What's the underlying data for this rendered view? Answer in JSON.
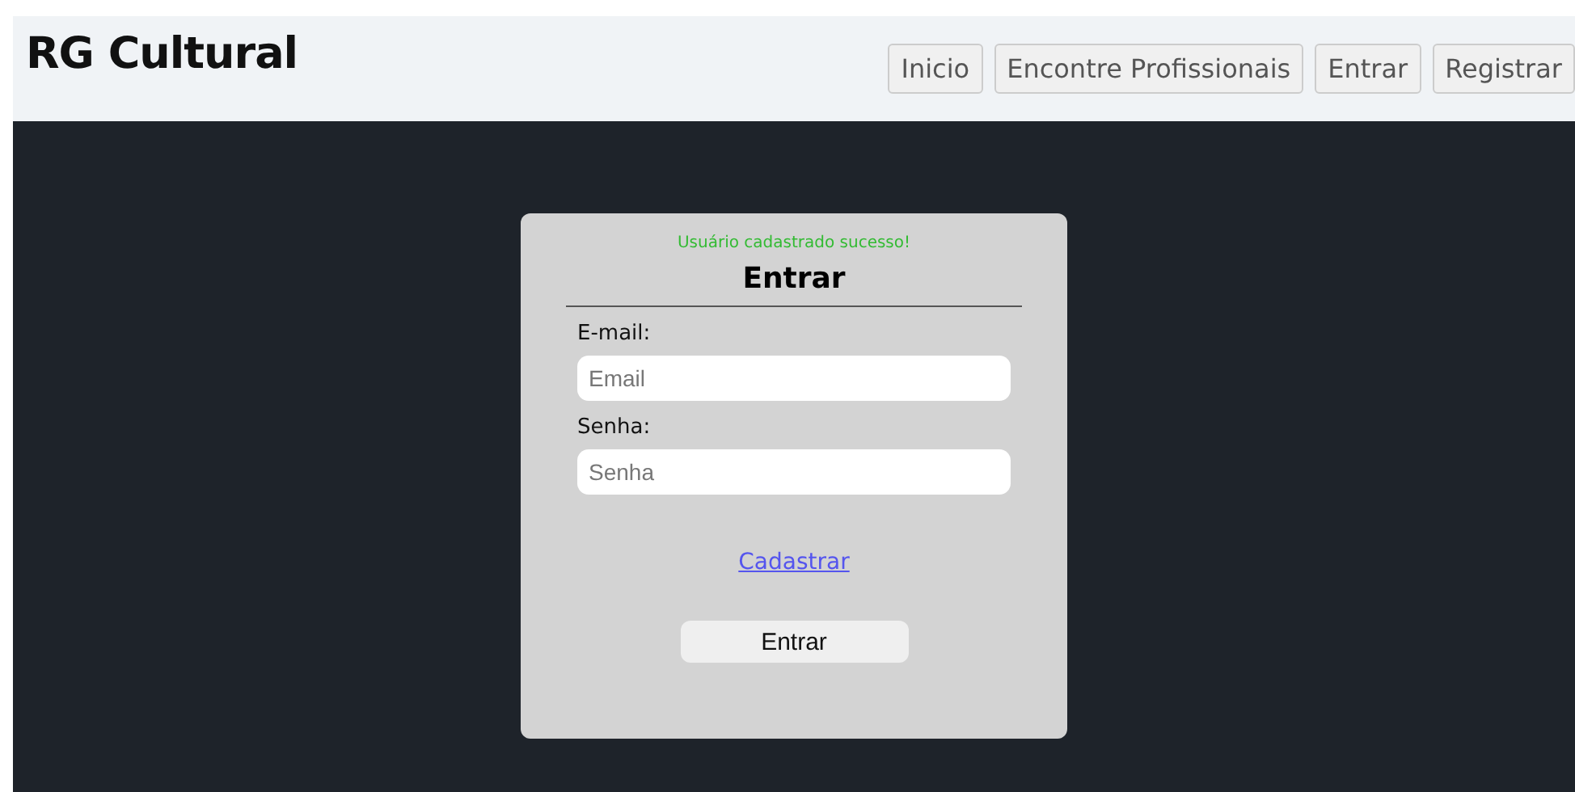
{
  "header": {
    "title": "RG Cultural",
    "nav": [
      "Inicio",
      "Encontre Profissionais",
      "Entrar",
      "Registrar"
    ]
  },
  "login": {
    "message": "Usuário cadastrado sucesso!",
    "title": "Entrar",
    "fields": [
      {
        "label": "E-mail:",
        "placeholder": "Email"
      },
      {
        "label": "Senha:",
        "placeholder": "Senha"
      }
    ],
    "link": "Cadastrar",
    "submit": "Entrar"
  }
}
